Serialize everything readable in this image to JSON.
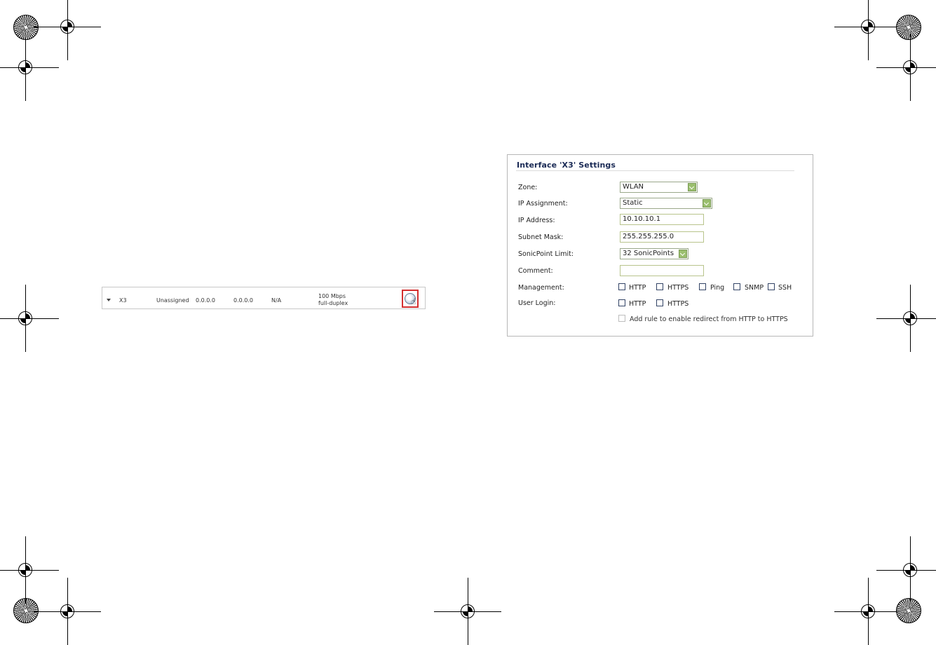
{
  "interface_row": {
    "name": "X3",
    "zone": "Unassigned",
    "ip": "0.0.0.0",
    "subnet": "0.0.0.0",
    "ip_mgmt": "N/A",
    "speed_line1": "100 Mbps",
    "speed_line2": "full-duplex",
    "configure_icon": "edit-configure-icon"
  },
  "dialog": {
    "title": "Interface 'X3' Settings",
    "zone": {
      "label": "Zone:",
      "value": "WLAN"
    },
    "ip_assignment": {
      "label": "IP Assignment:",
      "value": "Static"
    },
    "ip_address": {
      "label": "IP Address:",
      "value": "10.10.10.1"
    },
    "subnet_mask": {
      "label": "Subnet Mask:",
      "value": "255.255.255.0"
    },
    "sonicpoint_limit": {
      "label": "SonicPoint Limit:",
      "value": "32 SonicPoints"
    },
    "comment": {
      "label": "Comment:",
      "value": ""
    },
    "management": {
      "label": "Management:",
      "options": [
        "HTTP",
        "HTTPS",
        "Ping",
        "SNMP",
        "SSH"
      ]
    },
    "user_login": {
      "label": "User Login:",
      "options": [
        "HTTP",
        "HTTPS"
      ]
    },
    "redirect_label": "Add rule to enable redirect from HTTP to HTTPS"
  },
  "colors": {
    "highlight": "#d43030",
    "title": "#1a2a55",
    "dropdown_button": "#9bbf6f"
  }
}
